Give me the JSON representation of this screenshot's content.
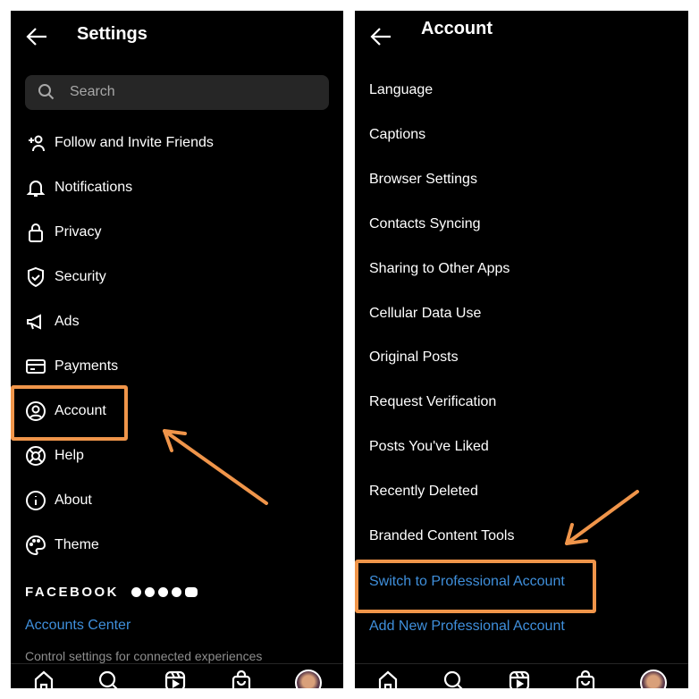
{
  "settings": {
    "title": "Settings",
    "search_placeholder": "Search",
    "items": [
      {
        "label": "Follow and Invite Friends",
        "icon": "add-person-icon"
      },
      {
        "label": "Notifications",
        "icon": "bell-icon"
      },
      {
        "label": "Privacy",
        "icon": "lock-icon"
      },
      {
        "label": "Security",
        "icon": "shield-icon"
      },
      {
        "label": "Ads",
        "icon": "megaphone-icon"
      },
      {
        "label": "Payments",
        "icon": "card-icon"
      },
      {
        "label": "Account",
        "icon": "user-circle-icon"
      },
      {
        "label": "Help",
        "icon": "lifebuoy-icon"
      },
      {
        "label": "About",
        "icon": "info-icon"
      },
      {
        "label": "Theme",
        "icon": "palette-icon"
      }
    ],
    "facebook_label": "FACEBOOK",
    "accounts_center": "Accounts Center",
    "accounts_center_sub": "Control settings for connected experiences"
  },
  "account": {
    "title": "Account",
    "items": [
      "Language",
      "Captions",
      "Browser Settings",
      "Contacts Syncing",
      "Sharing to Other Apps",
      "Cellular Data Use",
      "Original Posts",
      "Request Verification",
      "Posts You've Liked",
      "Recently Deleted",
      "Branded Content Tools"
    ],
    "switch_professional": "Switch to Professional Account",
    "add_professional": "Add New Professional Account"
  },
  "nav": [
    "home-icon",
    "search-icon",
    "reels-icon",
    "shop-icon",
    "profile-avatar"
  ],
  "colors": {
    "highlight": "#f0954a",
    "link": "#3f8fdb",
    "background": "#000000"
  }
}
